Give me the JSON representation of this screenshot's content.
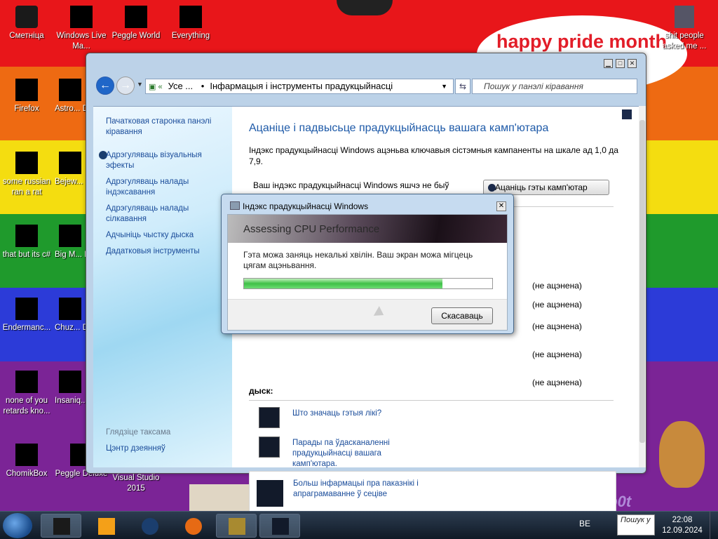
{
  "desktop": {
    "bubble_text": "happy pride month",
    "signature": "VM0b0t",
    "icons": [
      {
        "label": "Сметніца",
        "icon": "recycle-bin-icon"
      },
      {
        "label": "Windows Live Ma...",
        "icon": "windows-live-icon"
      },
      {
        "label": "Peggle World",
        "icon": "peggle-icon"
      },
      {
        "label": "Everything",
        "icon": "everything-icon"
      },
      {
        "label": "shit people asked me ...",
        "icon": "folder-icon"
      },
      {
        "label": "Firefox",
        "icon": "firefox-icon"
      },
      {
        "label": "Astro... Delu...",
        "icon": "game-icon"
      },
      {
        "label": "some russian ran a rat",
        "icon": "file-icon"
      },
      {
        "label": "Bejew... Delu...",
        "icon": "game-icon"
      },
      {
        "label": "that but its c#",
        "icon": "file-icon"
      },
      {
        "label": "Big M... Delu...",
        "icon": "game-icon"
      },
      {
        "label": "Endermanc...",
        "icon": "app-icon"
      },
      {
        "label": "Chuz... Delu...",
        "icon": "game-icon"
      },
      {
        "label": "none of you retards kno...",
        "icon": "app-icon"
      },
      {
        "label": "Insaniq... Delu...",
        "icon": "game-icon"
      },
      {
        "label": "ChomikBox",
        "icon": "chomikbox-icon"
      },
      {
        "label": "Peggle Deluxe",
        "icon": "peggle-icon"
      },
      {
        "label": "Visual Studio 2015",
        "icon": "visual-studio-icon"
      }
    ]
  },
  "window": {
    "breadcrumb_root": "Усе ...",
    "breadcrumb_sep": "•",
    "breadcrumb_current": "Інфармацыя і інструменты прадукцыйнасці",
    "search_placeholder": "Пошук у панэлі кіравання",
    "sidebar": {
      "home": "Пачатковая старонка панэлі кіравання",
      "links": [
        "Адрэгуляваць візуальныя эфекты",
        "Адрэгуляваць налады індэксавання",
        "Адрэгуляваць налады сілкавання",
        "Адчыніць чыстку дыска",
        "Дадатковыя інструменты"
      ],
      "see_also": "Глядзіце таксама",
      "action_center": "Цэнтр дзеянняў"
    },
    "content": {
      "title": "Ацаніце і падвысьце прадукцыйнасць вашага камп'ютара",
      "description": "Індэкс прадукцыйнасці Windows ацэньва ключавыя сістэмныя кампаненты на шкале ад 1,0 да 7,9.",
      "status": "Ваш індэкс прадукцыйнасці Windows яшчэ не быў устаноўлены",
      "rate_button": "Ацаніць гэты камп'ютар",
      "not_rated": [
        "(не ацэнена)",
        "(не ацэнена)",
        "(не ацэнена)",
        "(не ацэнена)",
        "(не ацэнена)"
      ],
      "disk_label": "дыск:",
      "link_what": "Што значаць гэтыя лікі?",
      "link_tips": "Парады па ўдасканаленні прадукцыйнасці вашага камп'ютара.",
      "more_info": "Больш інфармацыі пра паказнікі і апраграмаванне ў сеціве"
    }
  },
  "dialog": {
    "title": "Індэкс прадукцыйнасці Windows",
    "banner": "Assessing CPU Performance",
    "message": "Гэта можа заняць некалькі хвілін. Ваш экран можа мігцець цягам ацэньвання.",
    "progress": 0.8,
    "cancel": "Скасаваць"
  },
  "taskbar": {
    "lang": "BE",
    "search": "Пошук у",
    "time": "22:08",
    "date": "12.09.2024"
  },
  "colors": {
    "accent": "#1e5aa8",
    "progress": "#3fc047"
  }
}
